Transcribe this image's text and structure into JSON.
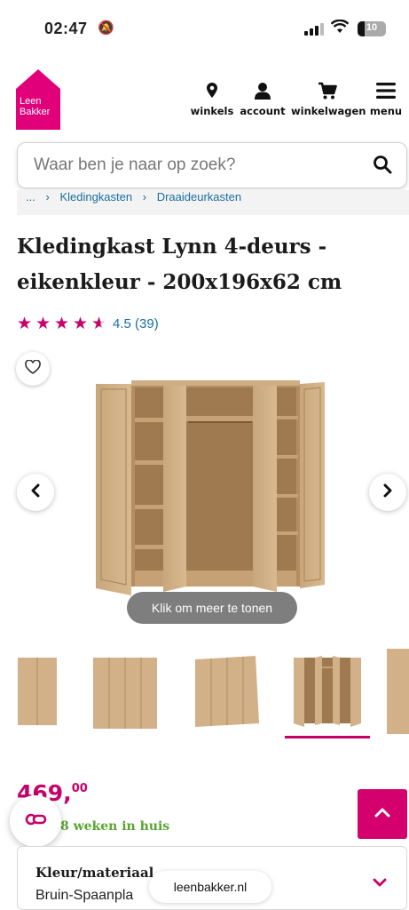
{
  "status_bar": {
    "time": "02:47",
    "battery": "10"
  },
  "brand": {
    "line1": "Leen",
    "line2": "Bakker",
    "color": "#e2007a"
  },
  "nav": [
    {
      "label": "winkels",
      "icon": "location-pin-icon"
    },
    {
      "label": "account",
      "icon": "user-icon"
    },
    {
      "label": "winkelwagen",
      "icon": "cart-icon"
    },
    {
      "label": "menu",
      "icon": "hamburger-menu-icon"
    }
  ],
  "search": {
    "placeholder": "Waar ben je naar op zoek?"
  },
  "breadcrumb": [
    "...",
    "Kledingkasten",
    "Draaideurkasten"
  ],
  "product": {
    "title": "Kledingkast Lynn 4-deurs - eikenkleur - 200x196x62 cm",
    "rating_value": "4.5",
    "rating_count": "(39)",
    "rating_display": "4.5 (39)",
    "stars": 4.5
  },
  "gallery": {
    "tooltip": "Klik om meer te tonen",
    "thumbnail_count": 5,
    "selected_thumbnail": 4
  },
  "price": {
    "whole": "469,",
    "cents": "00"
  },
  "delivery": {
    "text": "8 weken in huis"
  },
  "option": {
    "label": "Kleur/materiaal",
    "value": "Bruin-Spaanpla"
  },
  "browser": {
    "url": "leenbakker.nl"
  },
  "colors": {
    "accent": "#c8006a",
    "delivery_green": "#5aa531",
    "link_blue": "#1a6fa0"
  }
}
